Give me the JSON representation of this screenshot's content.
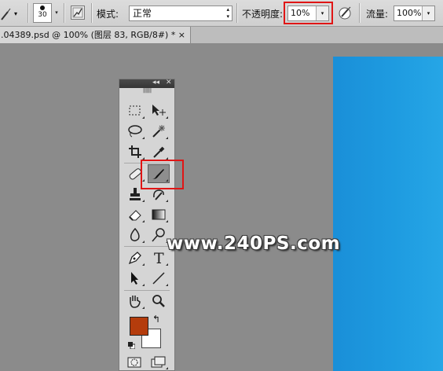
{
  "options_bar": {
    "tool_preset_icon": "brush-preset-icon",
    "brush_size": "30",
    "mode_label": "模式:",
    "mode_value": "正常",
    "opacity_label": "不透明度:",
    "opacity_value": "10%",
    "flow_label": "流量:",
    "flow_value": "100%",
    "airbrush_icon": "airbrush-icon",
    "pressure_icon": "pressure-toggle-icon"
  },
  "document_tab": {
    "title": ".04389.psd @ 100% (图层 83, RGB/8#) *",
    "close_glyph": "×"
  },
  "tools_panel": {
    "collapse_glyph": "◂◂",
    "close_glyph": "✕",
    "tools": [
      "rectangular-marquee-icon",
      "move-icon",
      "lasso-icon",
      "magic-wand-icon",
      "crop-icon",
      "eyedropper-icon",
      "healing-brush-icon",
      "brush-icon",
      "clone-stamp-icon",
      "history-brush-icon",
      "eraser-icon",
      "gradient-icon",
      "blur-icon",
      "dodge-icon",
      "pen-icon",
      "type-icon",
      "path-selection-icon",
      "line-icon",
      "hand-icon",
      "zoom-icon"
    ],
    "type_tool_glyph": "T",
    "active_tool": "brush-icon",
    "foreground_color": "#b43c0c",
    "background_color": "#ffffff",
    "swap_glyph": "↰"
  },
  "watermark": "www.240PS.com",
  "colors": {
    "highlight": "#e01515",
    "canvas": "#1e9be0",
    "workspace": "#8b8b8b"
  }
}
